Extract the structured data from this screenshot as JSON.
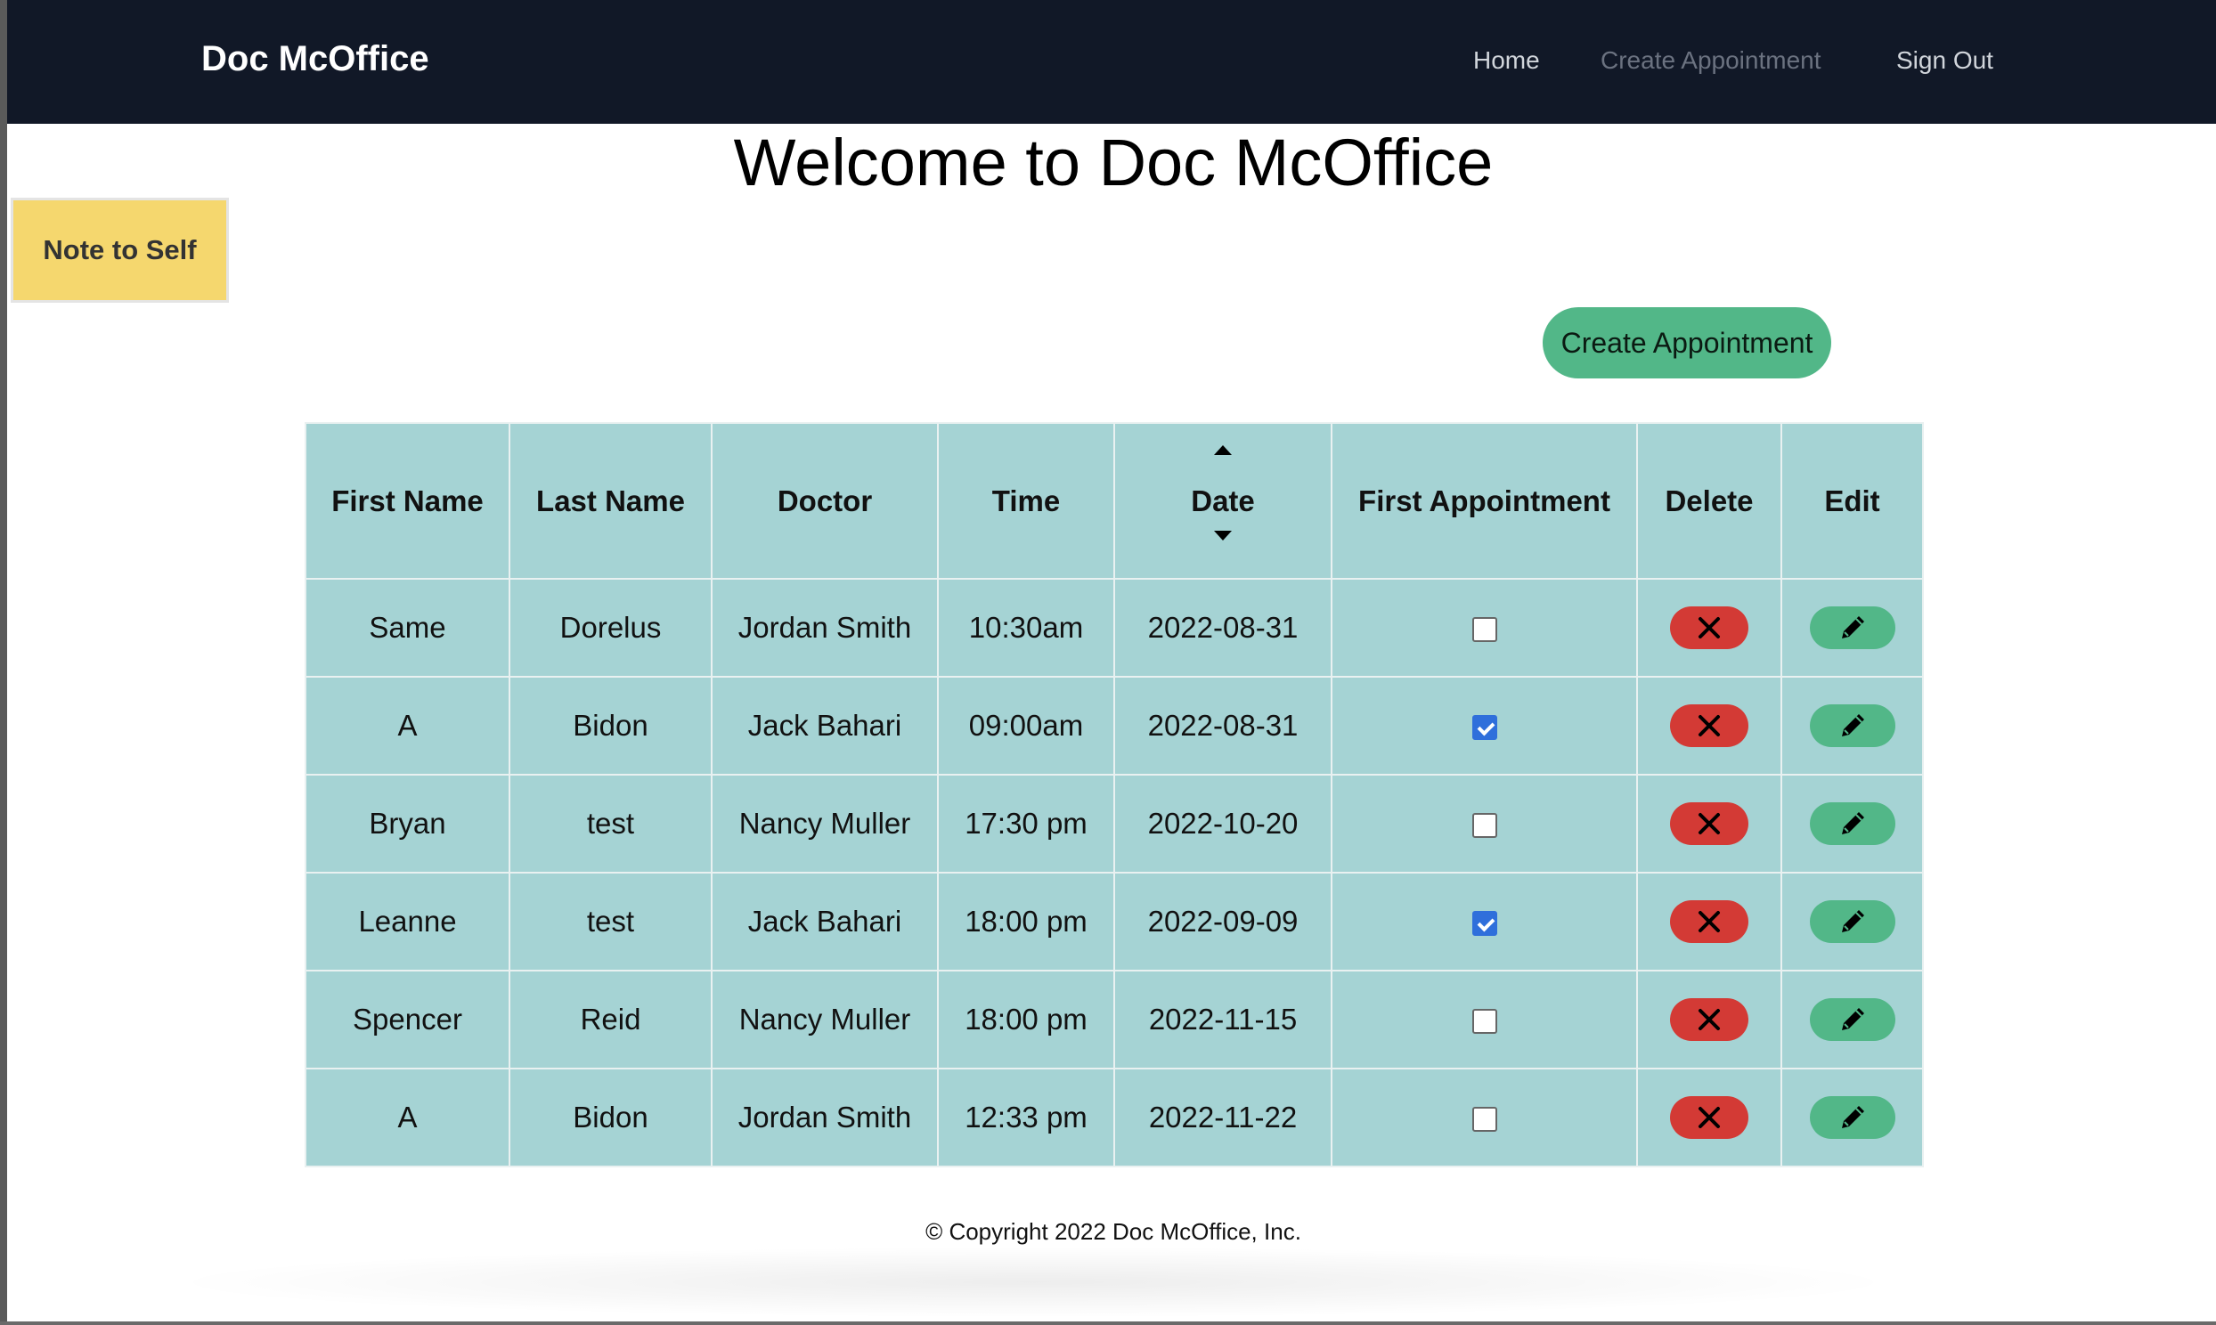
{
  "nav": {
    "brand": "Doc McOffice",
    "home": "Home",
    "create_appointment": "Create Appointment",
    "sign_out": "Sign Out"
  },
  "page_title": "Welcome to Doc McOffice",
  "note_button": "Note to Self",
  "create_button": "Create Appointment",
  "table": {
    "headers": [
      "First Name",
      "Last Name",
      "Doctor",
      "Time",
      "Date",
      "First Appointment",
      "Delete",
      "Edit"
    ],
    "rows": [
      {
        "first": "Same",
        "last": "Dorelus",
        "doctor": "Jordan Smith",
        "time": "10:30am",
        "date": "2022-08-31",
        "first_appt": false
      },
      {
        "first": "A",
        "last": "Bidon",
        "doctor": "Jack Bahari",
        "time": "09:00am",
        "date": "2022-08-31",
        "first_appt": true
      },
      {
        "first": "Bryan",
        "last": "test",
        "doctor": "Nancy Muller",
        "time": "17:30 pm",
        "date": "2022-10-20",
        "first_appt": false
      },
      {
        "first": "Leanne",
        "last": "test",
        "doctor": "Jack Bahari",
        "time": "18:00 pm",
        "date": "2022-09-09",
        "first_appt": true
      },
      {
        "first": "Spencer",
        "last": "Reid",
        "doctor": "Nancy Muller",
        "time": "18:00 pm",
        "date": "2022-11-15",
        "first_appt": false
      },
      {
        "first": "A",
        "last": "Bidon",
        "doctor": "Jordan Smith",
        "time": "12:33 pm",
        "date": "2022-11-22",
        "first_appt": false
      }
    ]
  },
  "icons": {
    "sort": "sort-arrows-icon",
    "delete": "x-icon",
    "edit": "pencil-icon"
  },
  "colors": {
    "navbar": "#111827",
    "table_bg": "#a5d3d4",
    "delete": "#d33a35",
    "edit": "#52b788",
    "note": "#f5d76e",
    "checkbox": "#2f6fdb"
  },
  "footer": "© Copyright 2022 Doc McOffice, Inc."
}
